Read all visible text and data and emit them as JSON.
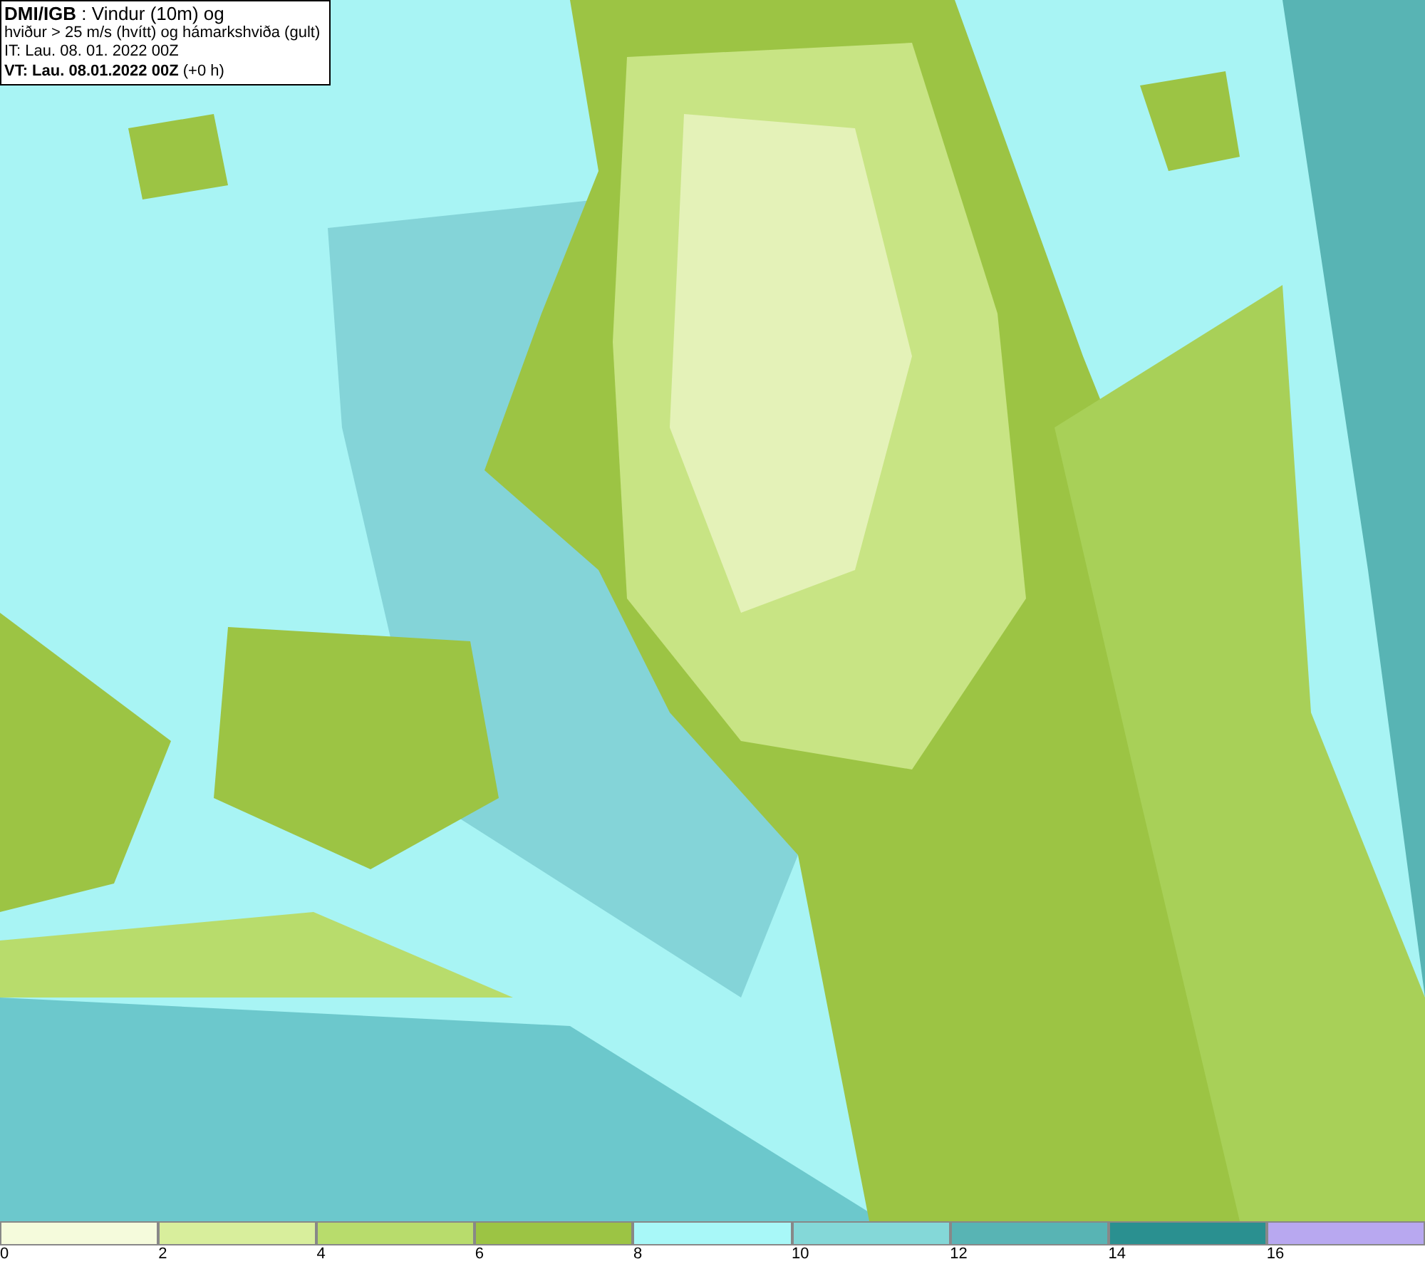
{
  "header": {
    "lines": [
      "**DMI/IGB** : Vindur (10m) og",
      "hviður > 25 m/s (hvítt) og hámarkshviða (gult)",
      "IT: Lau. 08. 01. 2022 00Z",
      "**VT: Lau. 08.01.2022 00Z** (+0 h)"
    ]
  },
  "legend": {
    "bins": [
      {
        "label": "0",
        "color": "#f5fbdc"
      },
      {
        "label": "2",
        "color": "#d8ee9c"
      },
      {
        "label": "4",
        "color": "#b8dc6c"
      },
      {
        "label": "6",
        "color": "#9cc444"
      },
      {
        "label": "8",
        "color": "#a8f8f8"
      },
      {
        "label": "10",
        "color": "#84d8d8"
      },
      {
        "label": "12",
        "color": "#58b4b4"
      },
      {
        "label": "14",
        "color": "#2a9090"
      },
      {
        "label": "16",
        "color": "#b8a8f0"
      }
    ]
  }
}
